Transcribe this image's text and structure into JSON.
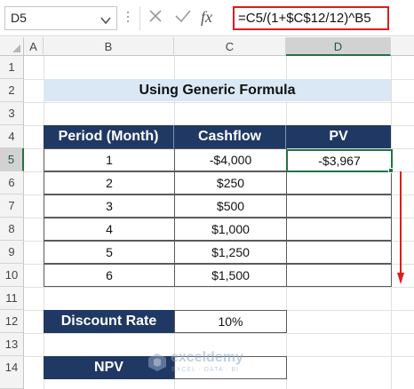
{
  "name_box": {
    "value": "D5"
  },
  "formula_bar": {
    "formula": "=C5/(1+$C$12/12)^B5",
    "fx_label": "fx"
  },
  "columns": [
    "A",
    "B",
    "C",
    "D"
  ],
  "rows": [
    "1",
    "2",
    "3",
    "4",
    "5",
    "6",
    "7",
    "8",
    "9",
    "10",
    "11",
    "12",
    "13",
    "14"
  ],
  "sheet": {
    "title": "Using Generic Formula",
    "headers": [
      "Period (Month)",
      "Cashflow",
      "PV"
    ],
    "table": [
      {
        "period": "1",
        "cashflow": "-$4,000",
        "pv": "-$3,967"
      },
      {
        "period": "2",
        "cashflow": "$250",
        "pv": ""
      },
      {
        "period": "3",
        "cashflow": "$500",
        "pv": ""
      },
      {
        "period": "4",
        "cashflow": "$1,000",
        "pv": ""
      },
      {
        "period": "5",
        "cashflow": "$1,250",
        "pv": ""
      },
      {
        "period": "6",
        "cashflow": "$1,500",
        "pv": ""
      }
    ],
    "discount_rate_label": "Discount Rate",
    "discount_rate_value": "10%",
    "npv_label": "NPV",
    "npv_value": ""
  },
  "watermark": {
    "brand": "exceldemy",
    "tagline": "EXCEL · DATA · BI"
  },
  "colors": {
    "header_fill": "#203864",
    "title_fill": "#dae8f5",
    "selection": "#217346",
    "highlight": "#e21b1b",
    "arrow": "#e21b1b"
  }
}
